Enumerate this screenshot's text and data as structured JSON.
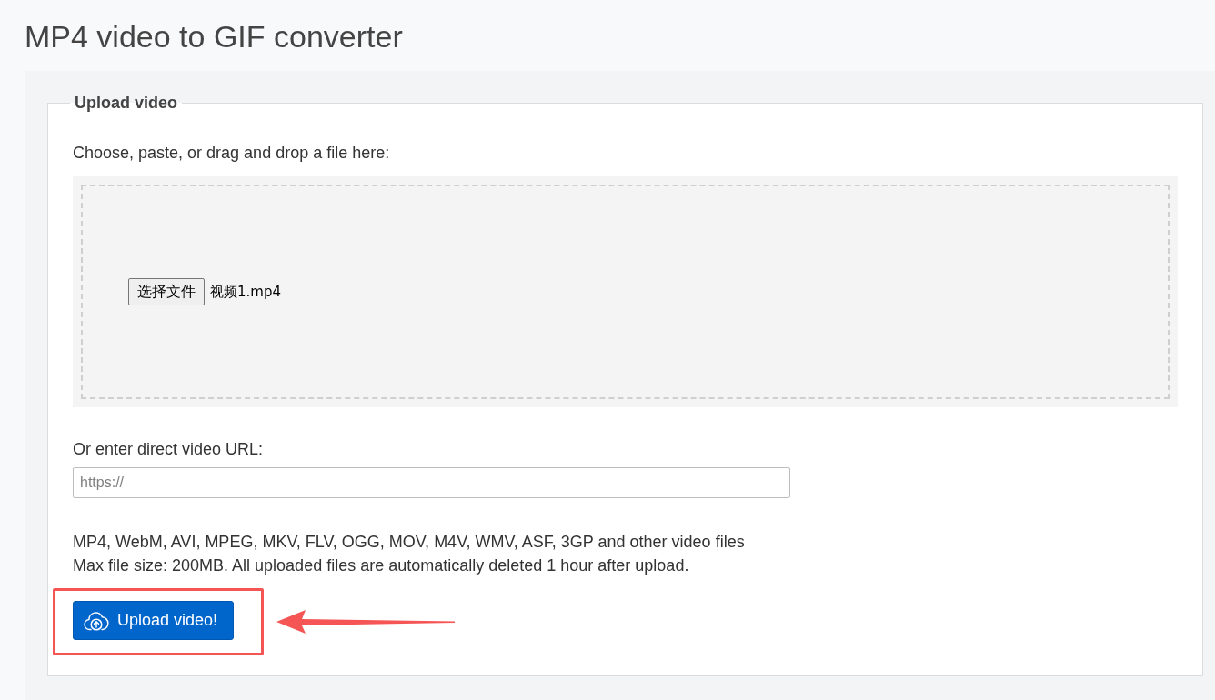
{
  "page": {
    "title": "MP4 video to GIF converter"
  },
  "upload_form": {
    "legend": "Upload video",
    "drop_zone": {
      "label": "Choose, paste, or drag and drop a file here:",
      "choose_button": "选择文件",
      "file_name": "视频1.mp4"
    },
    "url_field": {
      "label": "Or enter direct video URL:",
      "placeholder": "https://"
    },
    "notes": [
      "MP4, WebM, AVI, MPEG, MKV, FLV, OGG, MOV, M4V, WMV, ASF, 3GP and other video files",
      "Max file size: 200MB. All uploaded files are automatically deleted 1 hour after upload."
    ],
    "upload_button": {
      "label": "Upload video!",
      "highlighted": true
    }
  }
}
